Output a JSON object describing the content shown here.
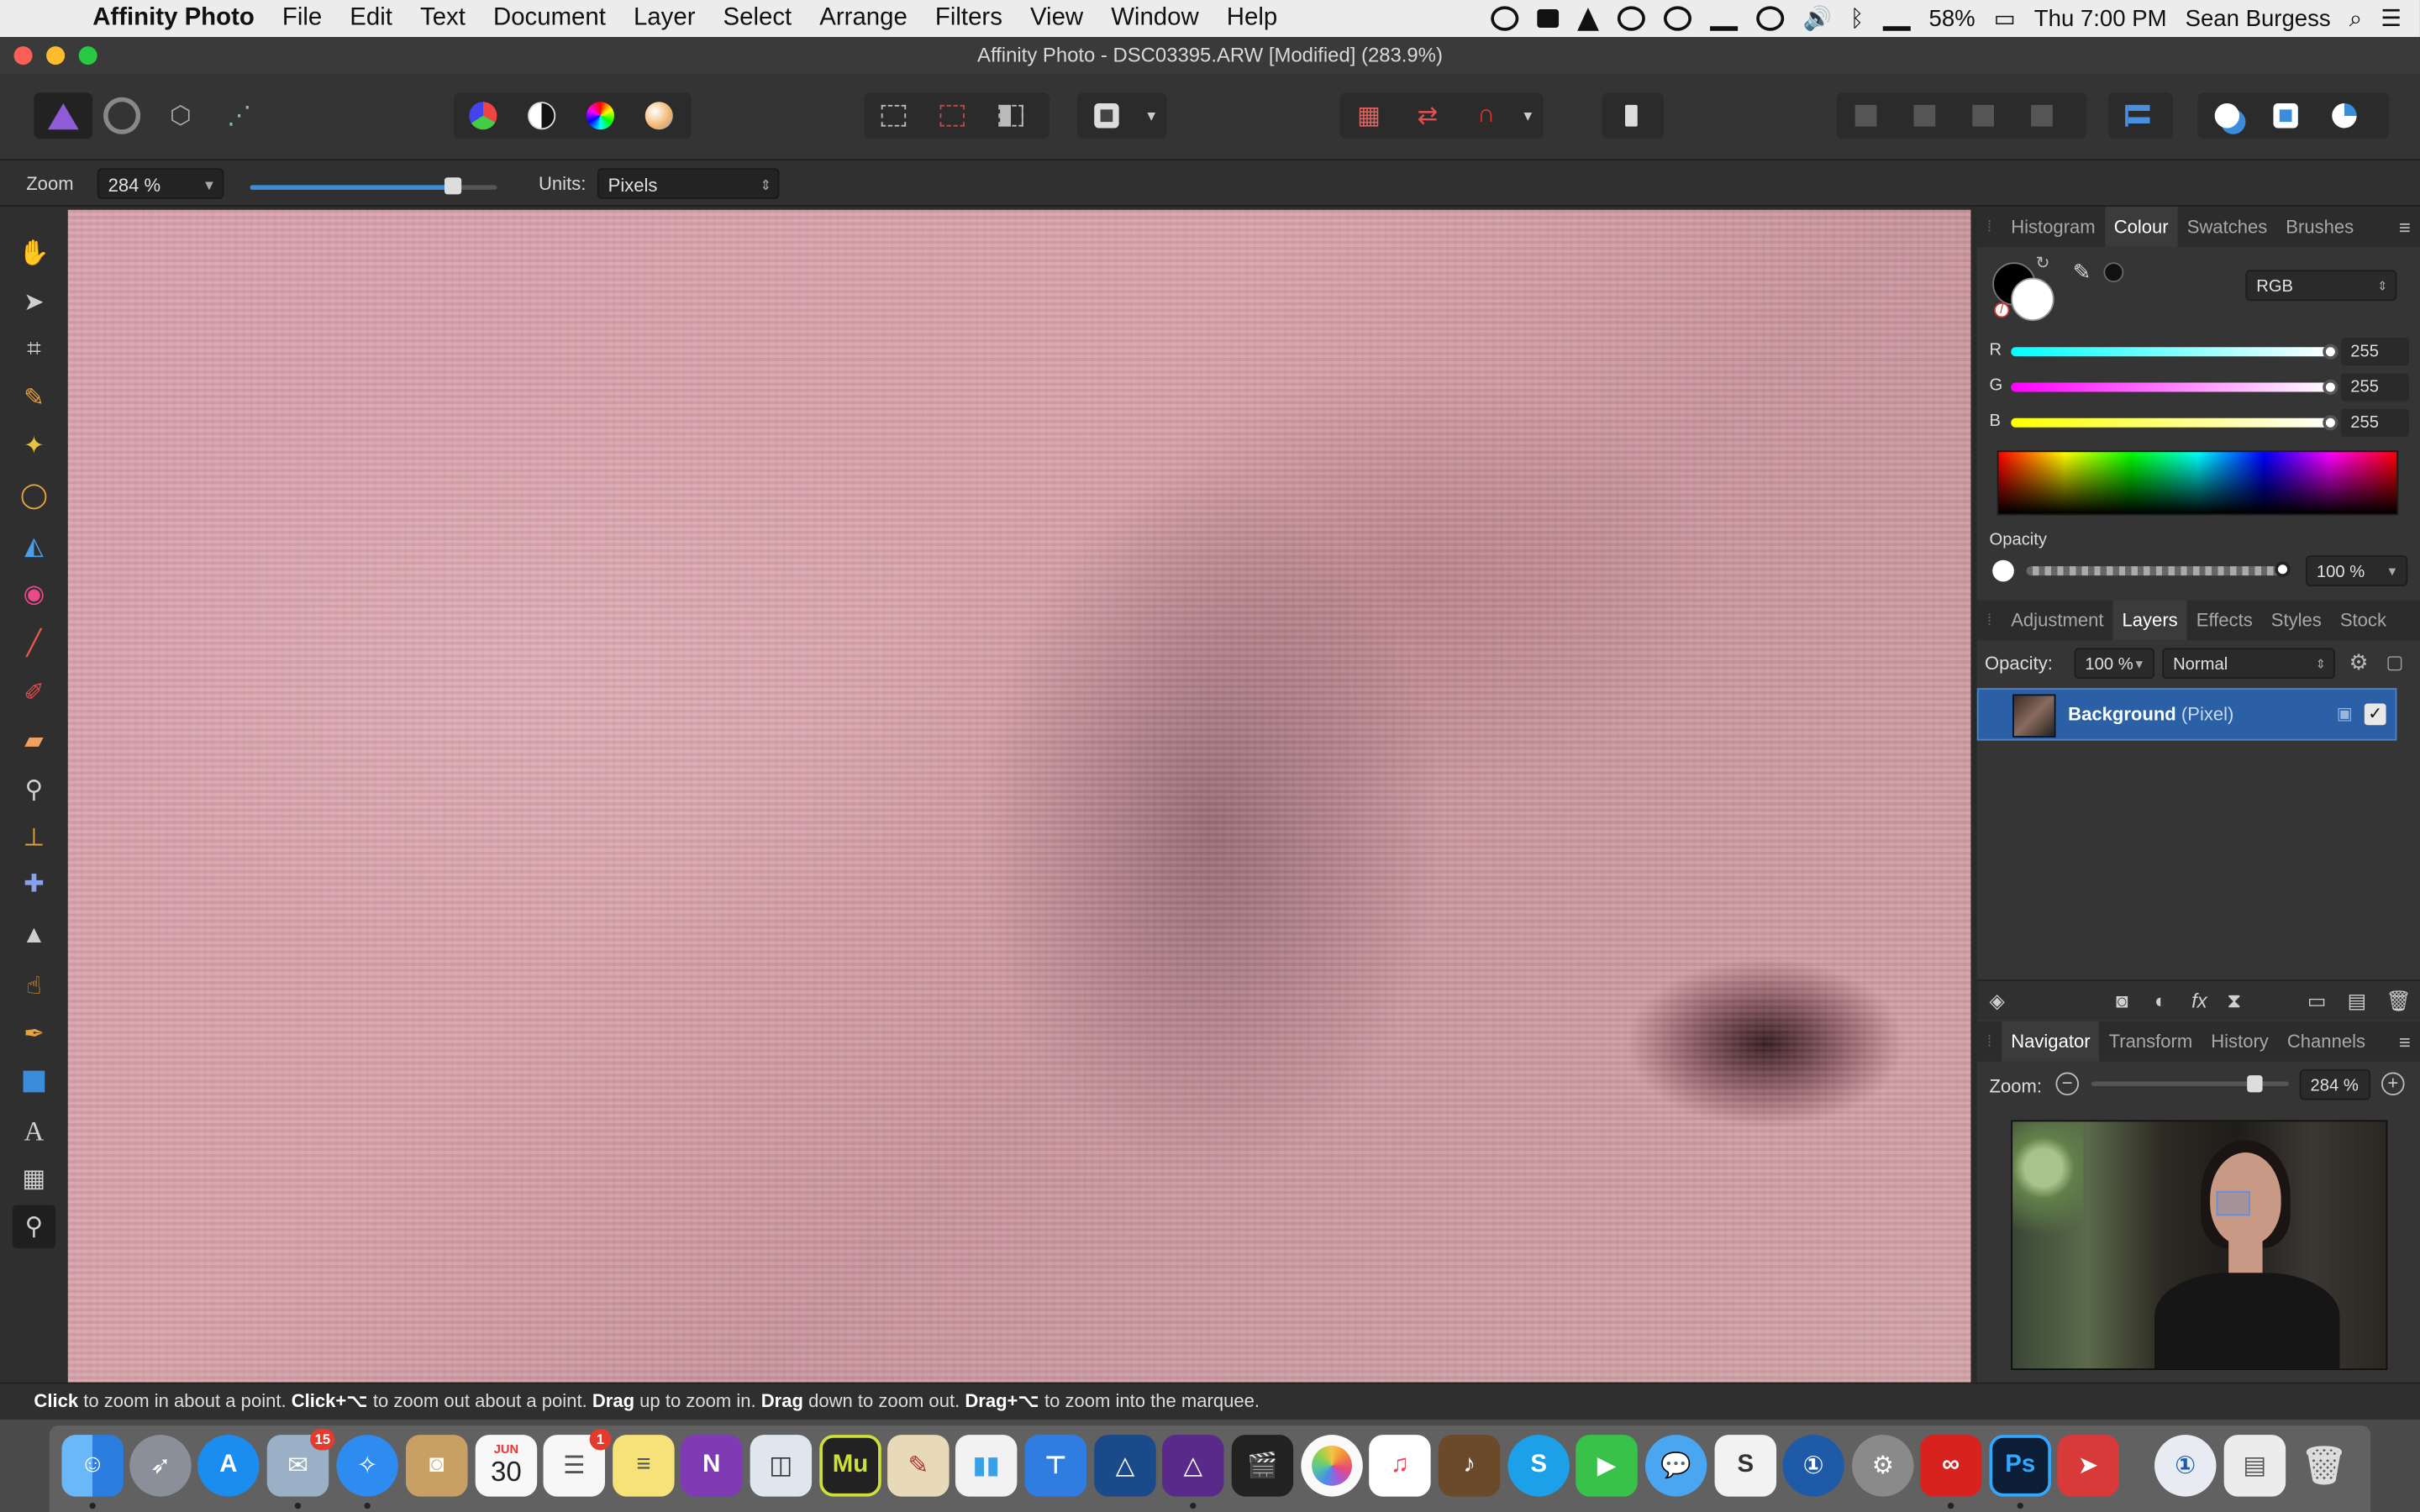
{
  "menubar": {
    "app_name": "Affinity Photo",
    "items": [
      "File",
      "Edit",
      "Text",
      "Document",
      "Layer",
      "Select",
      "Arrange",
      "Filters",
      "View",
      "Window",
      "Help"
    ],
    "battery": "58%",
    "clock": "Thu 7:00 PM",
    "user": "Sean Burgess"
  },
  "window": {
    "title": "Affinity Photo - DSC03395.ARW [Modified] (283.9%)"
  },
  "context_toolbar": {
    "zoom_label": "Zoom",
    "zoom_value": "284 %",
    "units_label": "Units:",
    "units_value": "Pixels"
  },
  "colour_panel": {
    "tabs": [
      "Histogram",
      "Colour",
      "Swatches",
      "Brushes"
    ],
    "active_tab": "Colour",
    "model": "RGB",
    "channels": [
      {
        "label": "R",
        "value": "255"
      },
      {
        "label": "G",
        "value": "255"
      },
      {
        "label": "B",
        "value": "255"
      }
    ],
    "opacity_label": "Opacity",
    "opacity_value": "100 %",
    "accent": "#3a8ddb"
  },
  "layers_panel": {
    "tabs": [
      "Adjustment",
      "Layers",
      "Effects",
      "Styles",
      "Stock"
    ],
    "active_tab": "Layers",
    "opacity_label": "Opacity:",
    "opacity_value": "100 %",
    "blend_mode": "Normal",
    "layer": {
      "name": "Background",
      "type": "(Pixel)",
      "checked": "✓"
    }
  },
  "navigator_panel": {
    "tabs": [
      "Navigator",
      "Transform",
      "History",
      "Channels"
    ],
    "active_tab": "Navigator",
    "zoom_label": "Zoom:",
    "zoom_value": "284 %"
  },
  "statusbar": {
    "w1": "Click",
    "t1": " to zoom in about a point. ",
    "w2": "Click+⌥",
    "t2": " to zoom out about a point. ",
    "w3": "Drag",
    "t3": " up to zoom in. ",
    "w4": "Drag",
    "t4": " down to zoom out. ",
    "w5": "Drag+⌥",
    "t5": " to zoom into the marquee."
  },
  "dock": {
    "calendar_month": "JUN",
    "calendar_day": "30",
    "mail_badge": "15",
    "reminders_badge": "1",
    "muse_label": "Mu",
    "photoshop_label": "Ps",
    "onenote_label": "N",
    "skype_label": "S"
  }
}
